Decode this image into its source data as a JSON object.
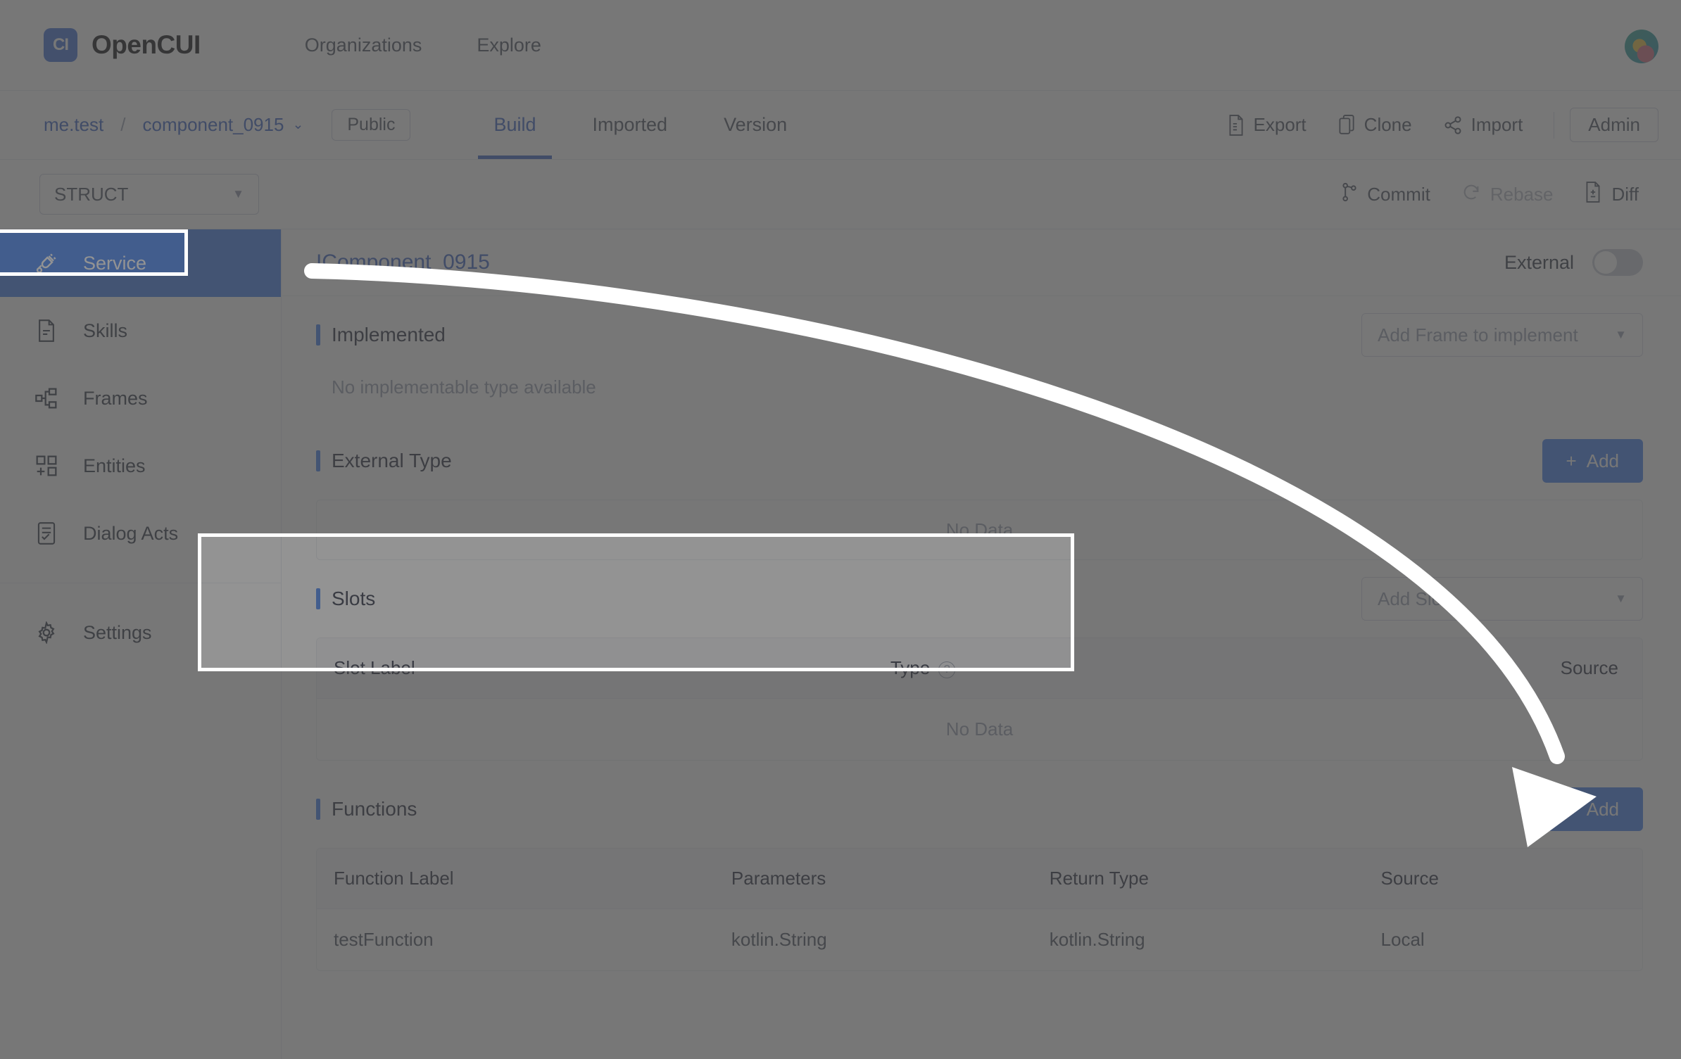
{
  "header": {
    "brand_mark": "CI",
    "brand_name": "OpenCUI",
    "nav": [
      {
        "label": "Organizations",
        "name": "nav-organizations"
      },
      {
        "label": "Explore",
        "name": "nav-explore"
      }
    ],
    "avatar_alt": "user-avatar"
  },
  "projectbar": {
    "org": "me.test",
    "separator": "/",
    "project": "component_0915",
    "project_caret": "⌄",
    "visibility": "Public",
    "tabs": [
      {
        "label": "Build",
        "active": true
      },
      {
        "label": "Imported",
        "active": false
      },
      {
        "label": "Version",
        "active": false
      }
    ],
    "actions": [
      {
        "label": "Export",
        "icon": "export-icon"
      },
      {
        "label": "Clone",
        "icon": "clone-icon"
      },
      {
        "label": "Import",
        "icon": "import-icon"
      }
    ],
    "admin_label": "Admin"
  },
  "subbar": {
    "struct_value": "STRUCT",
    "caret": "▼",
    "commit_label": "Commit",
    "rebase_label": "Rebase",
    "diff_label": "Diff"
  },
  "sidebar": {
    "items": [
      {
        "label": "Service",
        "icon": "service-plug-icon",
        "active": true
      },
      {
        "label": "Skills",
        "icon": "document-icon",
        "active": false
      },
      {
        "label": "Frames",
        "icon": "sitemap-icon",
        "active": false
      },
      {
        "label": "Entities",
        "icon": "blocks-icon",
        "active": false
      },
      {
        "label": "Dialog Acts",
        "icon": "list-card-icon",
        "active": false
      }
    ],
    "footer_items": [
      {
        "label": "Settings",
        "icon": "gear-icon",
        "active": false
      }
    ]
  },
  "main": {
    "title": "IComponent_0915",
    "external_label": "External",
    "external_on": false,
    "sections": {
      "implemented": {
        "title": "Implemented",
        "select_placeholder": "Add Frame to implement",
        "caret": "▼",
        "empty_text": "No implementable type available"
      },
      "external_type": {
        "title": "External Type",
        "add_label": "Add",
        "add_plus": "+",
        "empty_text": "No Data"
      },
      "slots": {
        "title": "Slots",
        "select_placeholder": "Add Slot",
        "caret": "▼",
        "columns": [
          "Slot Label",
          "Type",
          "Source"
        ],
        "type_help": "?",
        "empty_text": "No Data"
      },
      "functions": {
        "title": "Functions",
        "add_label": "Add",
        "add_plus": "+",
        "columns": [
          "Function Label",
          "Parameters",
          "Return Type",
          "Source"
        ],
        "rows": [
          {
            "function_label": "testFunction",
            "parameters": "kotlin.String",
            "return_type": "kotlin.String",
            "source": "Local"
          }
        ]
      }
    }
  },
  "colors": {
    "accent": "#3f7ef0",
    "link": "#3a62c4",
    "brand_bg": "#3f6fd8",
    "dim": "rgba(70,70,70,0.35)",
    "highlight_stroke": "#ffffff"
  }
}
